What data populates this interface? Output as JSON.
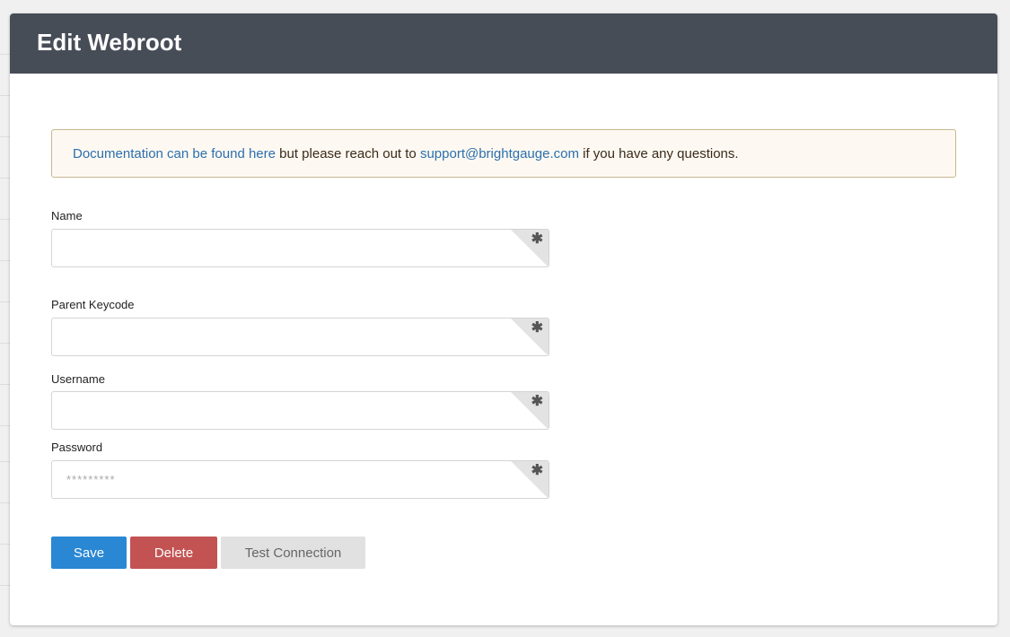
{
  "modal": {
    "title": "Edit Webroot"
  },
  "alert": {
    "doc_link": "Documentation can be found here",
    "middle_text": " but please reach out to ",
    "email_link": "support@brightgauge.com",
    "end_text": " if you have any questions."
  },
  "fields": {
    "name": {
      "label": "Name",
      "value": "",
      "placeholder": ""
    },
    "parent_keycode": {
      "label": "Parent Keycode",
      "value": "",
      "placeholder": ""
    },
    "username": {
      "label": "Username",
      "value": "",
      "placeholder": ""
    },
    "password": {
      "label": "Password",
      "value": "",
      "placeholder": "*********"
    },
    "required_marker": "✱"
  },
  "buttons": {
    "save": "Save",
    "delete": "Delete",
    "test": "Test Connection"
  },
  "colors": {
    "header_bg": "#474d57",
    "save": "#2a87d3",
    "delete": "#c35353",
    "test": "#e1e1e1",
    "link": "#2c6fad"
  }
}
